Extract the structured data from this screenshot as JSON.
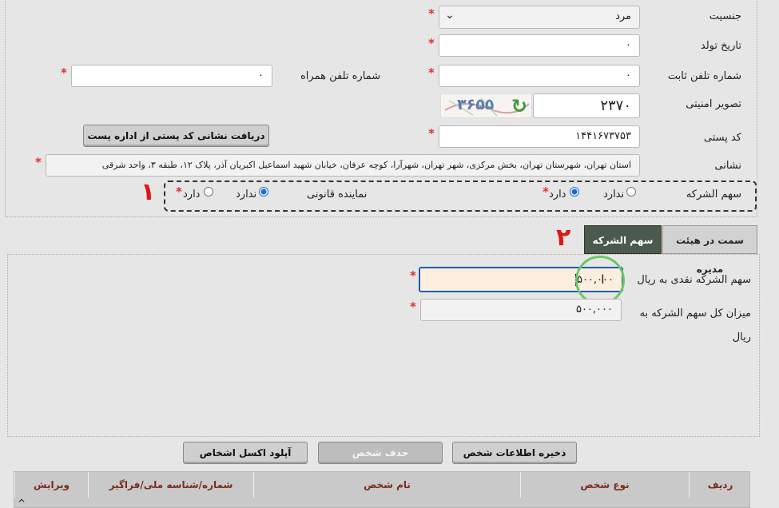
{
  "person": {
    "gender": {
      "label": "جنسیت",
      "value": "مرد",
      "dropdown_arrow": "⌄"
    },
    "birth_date": {
      "label": "تاریخ تولد",
      "value": "۰"
    },
    "mobile": {
      "label": "شماره تلفن همراه",
      "value": "۰"
    },
    "landline": {
      "label": "شماره تلفن ثابت",
      "value": "۰"
    },
    "captcha": {
      "label": "تصویر امنیتی",
      "value": "۲۳۷۰",
      "image_text": "۳۶۵۵"
    },
    "postal_code": {
      "label": "کد پستی",
      "value": "۱۴۴۱۶۷۳۷۵۳",
      "fetch_button": "دریافت نشانی کد پستی از اداره پست"
    },
    "address": {
      "label": "نشانی",
      "value": "استان تهران، شهرستان تهران، بخش مرکزی، شهر تهران، شهرآرا، کوچه عرفان، خیابان شهید اسماعیل اکبریان آذر، پلاک ۱۲، طبقه ۳، واحد شرقی"
    },
    "shareholder": {
      "label": "سهم الشرکه",
      "yes": "دارد",
      "no": "ندارد",
      "selected": "yes"
    },
    "legal_rep": {
      "label": "نماینده قانونی",
      "yes": "دارد",
      "no": "ندارد",
      "selected": "no"
    },
    "required_mark": "*"
  },
  "annotations": {
    "one": "۱",
    "two": "۲"
  },
  "tabs": [
    {
      "label": "سمت در هیئت مدیره",
      "active": false
    },
    {
      "label": "سهم الشرکه",
      "active": true
    }
  ],
  "shares": {
    "cash": {
      "label": "سهم الشرکه نقدی به ریال",
      "value": "۵۰۰,۰۰۰"
    },
    "total": {
      "label": "میزان کل سهم الشرکه به ریال",
      "value": "۵۰۰,۰۰۰"
    }
  },
  "buttons": {
    "save": "ذخیره اطلاعات شخص",
    "delete": "حذف شخص",
    "upload": "آپلود اکسل اشخاص"
  },
  "table": {
    "headers": [
      "ردیف",
      "نوع شخص",
      "نام شخص",
      "شماره/شناسه ملی/فراگیر",
      "ویرایش"
    ],
    "sort_glyph": "^"
  },
  "colors": {
    "accent": "#1a6fd6",
    "required": "#e03030",
    "tab_active": "#4a5a4f",
    "annotation": "#e01515"
  }
}
